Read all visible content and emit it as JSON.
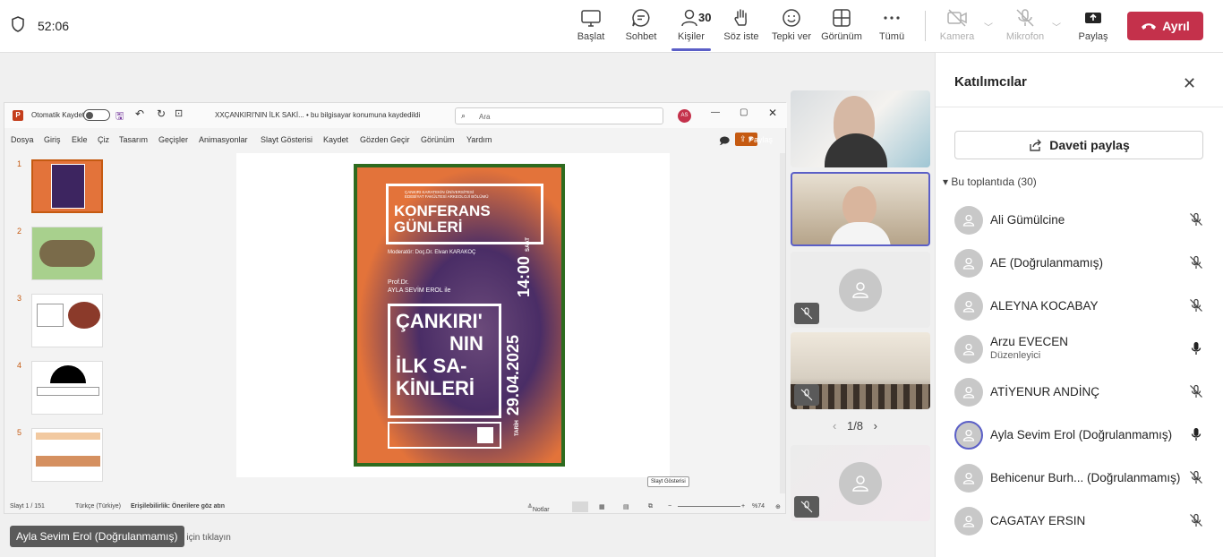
{
  "topbar": {
    "timer": "52:06",
    "buttons": [
      {
        "label": "Başlat",
        "icon": "share-screen-icon"
      },
      {
        "label": "Sohbet",
        "icon": "chat-icon"
      },
      {
        "label": "Kişiler",
        "icon": "people-icon",
        "count": "30"
      },
      {
        "label": "Söz iste",
        "icon": "raise-hand-icon"
      },
      {
        "label": "Tepki ver",
        "icon": "react-icon"
      },
      {
        "label": "Görünüm",
        "icon": "view-icon"
      },
      {
        "label": "Tümü",
        "icon": "more-icon"
      },
      {
        "label": "Kamera",
        "icon": "camera-off-icon"
      },
      {
        "label": "Mikrofon",
        "icon": "mic-off-icon"
      },
      {
        "label": "Paylaş",
        "icon": "share-icon"
      }
    ],
    "leave_label": "Ayrıl"
  },
  "ppt": {
    "autosave": "Otomatik Kaydet",
    "filename": "XXÇANKIRI'NIN İLK SAKİ...",
    "save_state": "• bu bilgisayar konumuna kaydedildi",
    "search_placeholder": "Ara",
    "user_initials": "AS",
    "menu": [
      "Dosya",
      "Giriş",
      "Ekle",
      "Çiz",
      "Tasarım",
      "Geçişler",
      "Animasyonlar",
      "Slayt Gösterisi",
      "Kaydet",
      "Gözden Geçir",
      "Görünüm",
      "Yardım"
    ],
    "share_label": "Paylaş",
    "slide_numbers": [
      "1",
      "2",
      "3",
      "4",
      "5"
    ],
    "notes_placeholder": "Not eklemek için tıklayın",
    "status": {
      "slide_count": "Slayt 1 / 151",
      "language": "Türkçe (Türkiye)",
      "accessibility": "Erişilebilirlik: Önerilere göz atın",
      "notes": "Notlar",
      "zoom": "%74"
    },
    "tooltip": "Slayt Gösterisi"
  },
  "poster": {
    "org_line1": "ÇANKIRI KARATEKİN ÜNİVERSİTESİ",
    "org_line2": "EDEBİYAT FAKÜLTESİ ARKEOLOJİ BÖLÜMÜ",
    "title_line1": "KONFERANS",
    "title_line2": "GÜNLERİ",
    "moderator": "Moderatör: Doç.Dr. Elvan KARAKOÇ",
    "speaker_title": "Prof.Dr.",
    "speaker": "AYLA SEVİM EROL ile",
    "topic_line1": "ÇANKIRI'",
    "topic_line2": "NIN",
    "topic_line3": "İLK SA-",
    "topic_line4": "KİNLERİ",
    "time": "14:00",
    "saat": "SAAT",
    "date": "29.04.2025",
    "tarih": "TARİH"
  },
  "video": {
    "pager": "1/8"
  },
  "panel": {
    "title": "Katılımcılar",
    "invite_label": "Daveti paylaş",
    "section_label": "Bu toplantıda (30)",
    "participants": [
      {
        "name": "Ali Gümülcine",
        "mic": "muted"
      },
      {
        "name": "AE (Doğrulanmamış)",
        "mic": "muted"
      },
      {
        "name": "ALEYNA KOCABAY",
        "mic": "muted"
      },
      {
        "name": "Arzu EVECEN",
        "role": "Düzenleyici",
        "mic": "on"
      },
      {
        "name": "ATİYENUR ANDİNÇ",
        "mic": "muted"
      },
      {
        "name": "Ayla Sevim Erol (Doğrulanmamış)",
        "mic": "on"
      },
      {
        "name": "Behicenur Burh... (Doğrulanmamış)",
        "mic": "muted"
      },
      {
        "name": "CAGATAY ERSIN",
        "mic": "muted"
      }
    ]
  },
  "speaker_chip": "Ayla Sevim Erol (Doğrulanmamış)",
  "colors": {
    "accent": "#5b5fc7",
    "leave": "#c4314b",
    "ppt_accent": "#c55a11"
  }
}
